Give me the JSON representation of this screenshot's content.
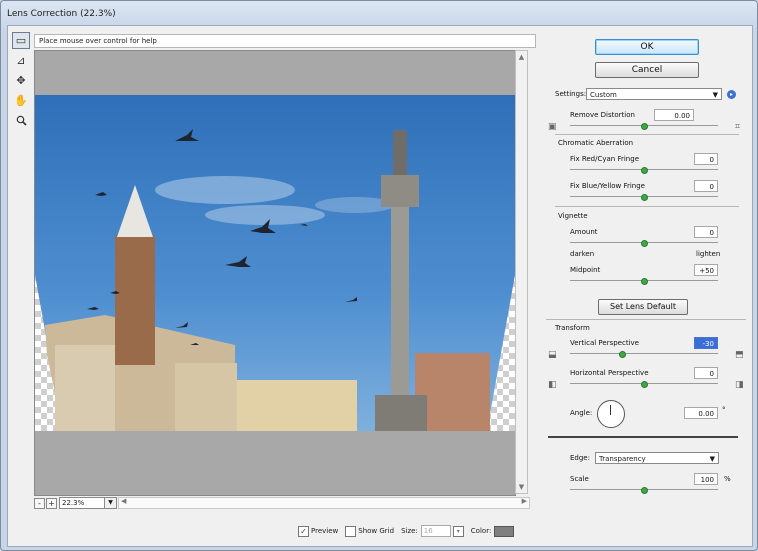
{
  "window": {
    "title": "Lens Correction (22.3%)"
  },
  "help_text": "Place mouse over control for help",
  "tools": [
    {
      "icon": "remove-distortion-tool-icon",
      "glyph": "▭"
    },
    {
      "icon": "straighten-tool-icon",
      "glyph": "⊿"
    },
    {
      "icon": "move-grid-tool-icon",
      "glyph": "✥"
    },
    {
      "icon": "hand-tool-icon",
      "glyph": "✋"
    },
    {
      "icon": "zoom-tool-icon",
      "glyph": "🔍"
    }
  ],
  "buttons": {
    "ok": "OK",
    "cancel": "Cancel",
    "set_lens_default": "Set Lens Default"
  },
  "settings": {
    "label": "Settings:",
    "value": "Custom"
  },
  "remove_distortion": {
    "label": "Remove Distortion",
    "value": "0.00",
    "level": 0.5
  },
  "chromatic": {
    "title": "Chromatic Aberration",
    "red_cyan": {
      "label": "Fix Red/Cyan Fringe",
      "value": "0",
      "level": 0.5
    },
    "blue_yellow": {
      "label": "Fix Blue/Yellow Fringe",
      "value": "0",
      "level": 0.5
    }
  },
  "vignette": {
    "title": "Vignette",
    "amount": {
      "label": "Amount",
      "value": "0",
      "level": 0.5
    },
    "darken": "darken",
    "lighten": "lighten",
    "midpoint": {
      "label": "Midpoint",
      "value": "+50",
      "level": 0.5
    }
  },
  "transform": {
    "title": "Transform",
    "vertical": {
      "label": "Vertical Perspective",
      "value": "-30",
      "level": 0.35
    },
    "horizontal": {
      "label": "Horizontal Perspective",
      "value": "0",
      "level": 0.5
    },
    "angle": {
      "label": "Angle:",
      "value": "0.00",
      "unit": "°"
    }
  },
  "edge": {
    "label": "Edge:",
    "value": "Transparency"
  },
  "scale": {
    "label": "Scale",
    "value": "100",
    "unit": "%",
    "level": 0.5
  },
  "zoom": {
    "minus": "-",
    "plus": "+",
    "value": "22.3%"
  },
  "options": {
    "preview": {
      "label": "Preview",
      "checked": "✓"
    },
    "show_grid": {
      "label": "Show Grid",
      "checked": ""
    },
    "size": {
      "label": "Size:",
      "value": "16"
    },
    "color": {
      "label": "Color:",
      "swatch": "#7f7f7f"
    }
  }
}
